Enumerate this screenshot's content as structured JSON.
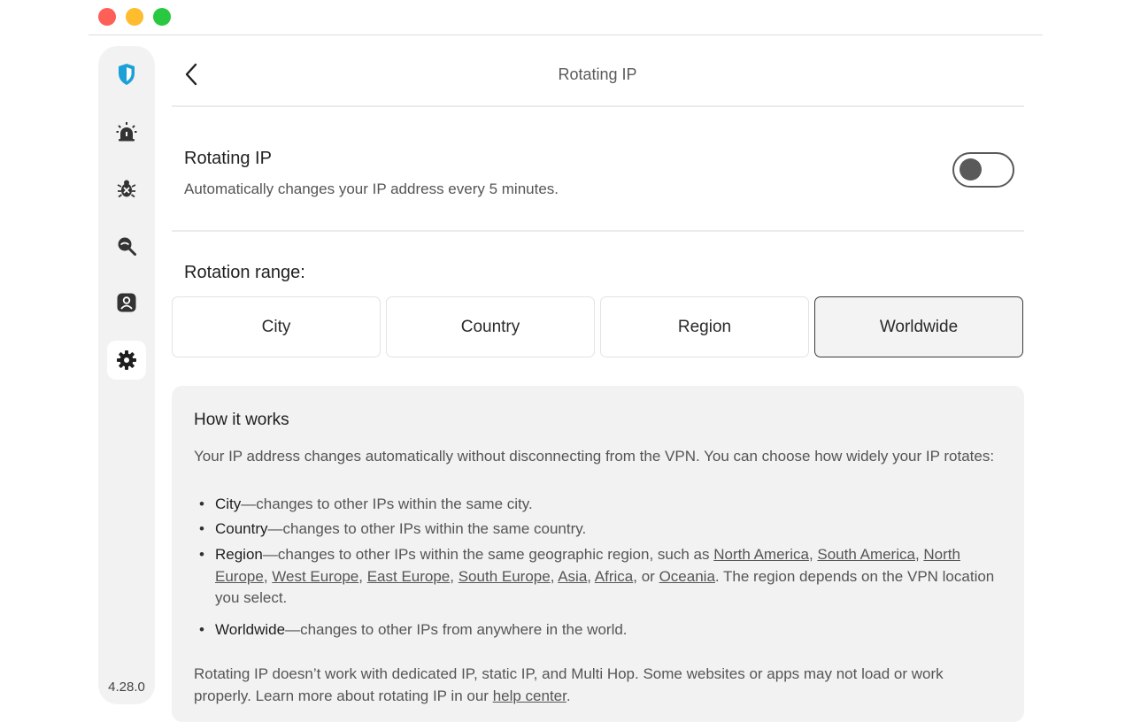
{
  "header": {
    "title": "Rotating IP"
  },
  "sidebar": {
    "items": [
      {
        "icon": "shield-logo-icon"
      },
      {
        "icon": "alarm-icon"
      },
      {
        "icon": "bug-icon"
      },
      {
        "icon": "search-eye-icon"
      },
      {
        "icon": "account-icon"
      },
      {
        "icon": "gear-icon",
        "active": true
      }
    ],
    "version": "4.28.0"
  },
  "setting": {
    "title": "Rotating IP",
    "description": "Automatically changes your IP address every 5 minutes.",
    "enabled": false
  },
  "rotation": {
    "label": "Rotation range:",
    "options": [
      "City",
      "Country",
      "Region",
      "Worldwide"
    ],
    "selected": "Worldwide"
  },
  "how_it_works": {
    "title": "How it works",
    "intro": "Your IP address changes automatically without disconnecting from the VPN. You can choose how widely your IP rotates:",
    "bullets": [
      {
        "term": "City",
        "text": "—changes to other IPs within the same city."
      },
      {
        "term": "Country",
        "text": "—changes to other IPs within the same country."
      },
      {
        "term": "Region",
        "text_before": "—changes to other IPs within the same geographic region, such as ",
        "regions": [
          "North America",
          "South America",
          "North Europe",
          "West Europe",
          "East Europe",
          "South Europe",
          "Asia",
          "Africa",
          "Oceania"
        ],
        "or_word": "or",
        "text_after": ". The region depends on the VPN location you select."
      },
      {
        "term": "Worldwide",
        "text": "—changes to other IPs from anywhere in the world."
      }
    ],
    "note_before": "Rotating IP doesn’t work with dedicated IP, static IP, and Multi Hop. Some websites or apps may not load or work properly. Learn more about rotating IP in our ",
    "note_link": "help center",
    "note_after": "."
  },
  "colors": {
    "traffic_red": "#fe5f57",
    "traffic_yellow": "#febc2e",
    "traffic_green": "#28c840",
    "shield": "#1ba0d8"
  }
}
